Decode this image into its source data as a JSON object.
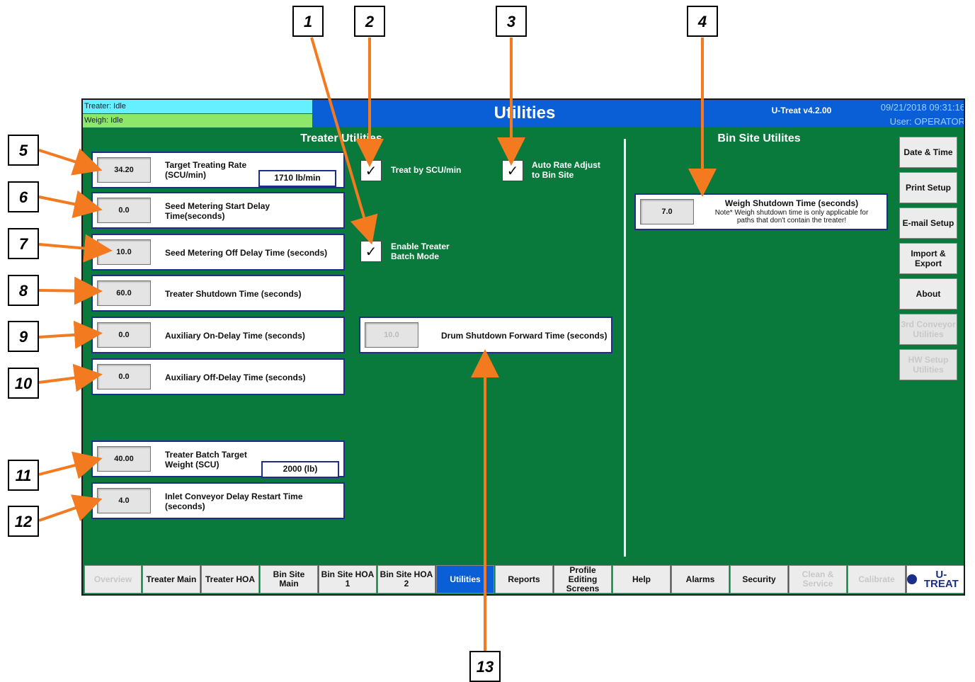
{
  "status": {
    "treater": "Treater: Idle",
    "weigh": "Weigh: Idle"
  },
  "header": {
    "title": "Utilities",
    "version": "U-Treat v4.2.00",
    "datetime": "09/21/2018 09:31:16",
    "user": "User: OPERATOR"
  },
  "sections": {
    "treater": "Treater Utilities",
    "binsite": "Bin Site Utilites"
  },
  "params": [
    {
      "value": "34.20",
      "label1": "Target Treating Rate",
      "label2": "(SCU/min)",
      "unit": "1710  lb/min"
    },
    {
      "value": "0.0",
      "label1": "Seed Metering Start Delay",
      "label2": "Time(seconds)"
    },
    {
      "value": "10.0",
      "label1": "Seed Metering Off Delay Time (seconds)",
      "label2": ""
    },
    {
      "value": "60.0",
      "label1": "Treater Shutdown Time (seconds)",
      "label2": ""
    },
    {
      "value": "0.0",
      "label1": "Auxiliary On-Delay Time (seconds)",
      "label2": ""
    },
    {
      "value": "0.0",
      "label1": "Auxiliary Off-Delay Time (seconds)",
      "label2": ""
    },
    {
      "value": "40.00",
      "label1": "Treater Batch Target",
      "label2": "Weight (SCU)",
      "unit": "2000  (lb)"
    },
    {
      "value": "4.0",
      "label1": "Inlet Conveyor Delay Restart Time",
      "label2": "(seconds)"
    }
  ],
  "checks": {
    "treat_scu": {
      "label1": "Treat by SCU/min",
      "label2": "",
      "mark": "✓"
    },
    "auto_rate": {
      "label1": "Auto Rate Adjust",
      "label2": "to Bin Site",
      "mark": "✓"
    },
    "batch_mode": {
      "label1": "Enable Treater",
      "label2": "Batch Mode",
      "mark": "✓"
    }
  },
  "drum": {
    "value": "10.0",
    "label": "Drum Shutdown Forward Time (seconds)"
  },
  "weigh_shutdown": {
    "value": "7.0",
    "label": "Weigh Shutdown Time (seconds)",
    "note1": "Note* Weigh shutdown time is only applicable for",
    "note2": "paths that don't contain the treater!"
  },
  "side_buttons": [
    {
      "l1": "Date & Time",
      "l2": ""
    },
    {
      "l1": "Print Setup",
      "l2": ""
    },
    {
      "l1": "E-mail Setup",
      "l2": ""
    },
    {
      "l1": "Import &",
      "l2": "Export"
    },
    {
      "l1": "About",
      "l2": ""
    },
    {
      "l1": "3rd Conveyor",
      "l2": "Utilities"
    },
    {
      "l1": "HW Setup",
      "l2": "Utilities"
    }
  ],
  "nav": [
    {
      "l1": "Overview",
      "l2": ""
    },
    {
      "l1": "Treater Main",
      "l2": ""
    },
    {
      "l1": "Treater HOA",
      "l2": ""
    },
    {
      "l1": "Bin Site",
      "l2": "Main"
    },
    {
      "l1": "Bin Site HOA",
      "l2": "1"
    },
    {
      "l1": "Bin Site HOA",
      "l2": "2"
    },
    {
      "l1": "Utilities",
      "l2": ""
    },
    {
      "l1": "Reports",
      "l2": ""
    },
    {
      "l1": "Profile",
      "l2": "Editing",
      "l3": "Screens"
    },
    {
      "l1": "Help",
      "l2": ""
    },
    {
      "l1": "Alarms",
      "l2": ""
    },
    {
      "l1": "Security",
      "l2": ""
    },
    {
      "l1": "Clean &",
      "l2": "Service"
    },
    {
      "l1": "Calibrate",
      "l2": ""
    }
  ],
  "logo": "U-TREAT",
  "callouts": [
    "1",
    "2",
    "3",
    "4",
    "5",
    "6",
    "7",
    "8",
    "9",
    "10",
    "11",
    "12",
    "13"
  ],
  "colors": {
    "screen_bg": "#0a7a3c",
    "header_bg": "#0a5fd6",
    "status_treater": "#66f0ff",
    "status_weigh": "#8de86a",
    "arrow": "#f47a20"
  }
}
